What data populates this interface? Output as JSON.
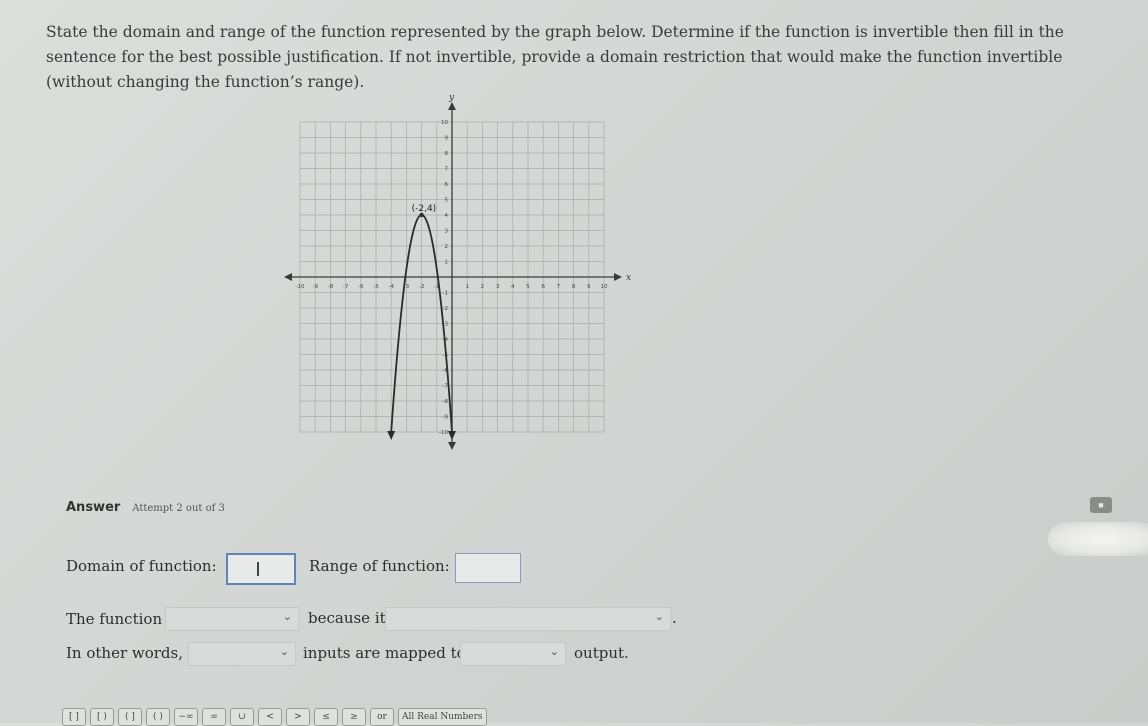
{
  "prompt": {
    "text": "State the domain and range of the function represented by the graph below. Determine if the function is invertible then fill in the sentence for the best possible justification. If not invertible, provide a domain restriction that would make the function invertible (without changing the function’s range)."
  },
  "graph": {
    "x_axis_label": "x",
    "y_axis_label": "y",
    "x_ticks": [
      -10,
      -9,
      -8,
      -7,
      -6,
      -5,
      -4,
      -3,
      -2,
      -1,
      1,
      2,
      3,
      4,
      5,
      6,
      7,
      8,
      9,
      10
    ],
    "y_ticks": [
      10,
      9,
      8,
      7,
      6,
      5,
      4,
      3,
      2,
      1,
      -1,
      -2,
      -3,
      -4,
      -5,
      -6,
      -7,
      -8,
      -9,
      -10
    ],
    "vertex_label": "(-2,4)",
    "vertex": {
      "x": -2,
      "y": 4
    },
    "curve_left_end": {
      "x": -4,
      "y": -10
    },
    "curve_right_end": {
      "x": 0,
      "y": -10
    },
    "colors": {
      "grid": "#a9aca9",
      "axis": "#3a3a3a",
      "curve": "#2b2b2b"
    }
  },
  "answer": {
    "label": "Answer",
    "attempt": "Attempt 2 out of 3",
    "calculator_icon": "calculator-icon"
  },
  "form": {
    "domain_label": "Domain of function:",
    "range_label": "Range of function:",
    "function_label": "The function",
    "because_label": "because it",
    "period": ".",
    "other_words_label": "In other words,",
    "inputs_label": "inputs are mapped to",
    "output_label": "output."
  },
  "toolbar": {
    "buttons": [
      "[ ]",
      "[ )",
      "( ]",
      "( )",
      "−∞",
      "∞",
      "∪",
      "<",
      ">",
      "≤",
      "≥",
      "or",
      "All Real Numbers"
    ]
  }
}
